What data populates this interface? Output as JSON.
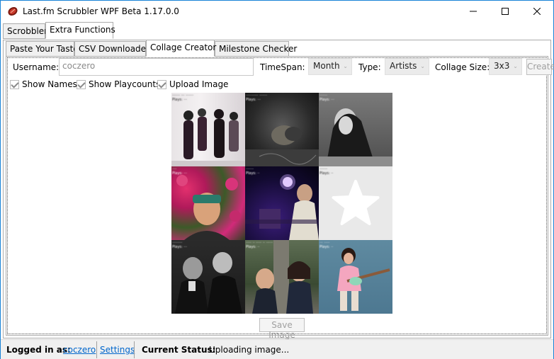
{
  "window": {
    "title": "Last.fm Scrubbler WPF Beta 1.17.0.0",
    "controls": [
      "minimize",
      "maximize",
      "close"
    ]
  },
  "main_tabs": [
    {
      "label": "Scrobbler",
      "active": false
    },
    {
      "label": "Extra Functions",
      "active": true
    }
  ],
  "sub_tabs": [
    {
      "label": "Paste Your Taste",
      "active": false
    },
    {
      "label": "CSV Downloader",
      "active": false
    },
    {
      "label": "Collage Creator",
      "active": true
    },
    {
      "label": "Milestone Checker",
      "active": false
    }
  ],
  "form": {
    "username_label": "Username:",
    "username_value": "coczero",
    "timespan_label": "TimeSpan:",
    "timespan_value": "Month",
    "type_label": "Type:",
    "type_value": "Artists",
    "collage_size_label": "Collage Size:",
    "collage_size_value": "3x3",
    "create_label": "Create",
    "show_names_label": "Show Names",
    "show_names_checked": true,
    "show_playcounts_label": "Show Playcounts",
    "show_playcounts_checked": true,
    "upload_image_label": "Upload Image",
    "upload_image_checked": true
  },
  "collage": {
    "tiles": [
      {
        "caption_line1": "·······  ··· ·······",
        "caption_line2": "Plays: ···",
        "style": "bw-band"
      },
      {
        "caption_line1": "··········· ·······",
        "caption_line2": "Plays: ···",
        "style": "bw-dark"
      },
      {
        "caption_line1": "·······",
        "caption_line2": "Plays: ···",
        "style": "bw-portrait"
      },
      {
        "caption_line1": "····",
        "caption_line2": "Plays: ···",
        "style": "flowers"
      },
      {
        "caption_line1": "·······",
        "caption_line2": "Plays: ··",
        "style": "stage"
      },
      {
        "caption_line1": "·······",
        "caption_line2": "Plays: ··",
        "style": "placeholder-star"
      },
      {
        "caption_line1": "·········",
        "caption_line2": "Plays: ···",
        "style": "bw-duo"
      },
      {
        "caption_line1": "····· ·· ····· ·· ······",
        "caption_line2": "Plays: ··",
        "style": "forest-duo"
      },
      {
        "caption_line1": "··· ·····",
        "caption_line2": "Plays: ··",
        "style": "guitarist-sea"
      }
    ],
    "save_label": "Save Image"
  },
  "statusbar": {
    "logged_in_label": "Logged in as:",
    "username_link": "coczero",
    "settings_link": "Settings",
    "status_label": "Current Status:",
    "status_value": "Uploading image..."
  }
}
